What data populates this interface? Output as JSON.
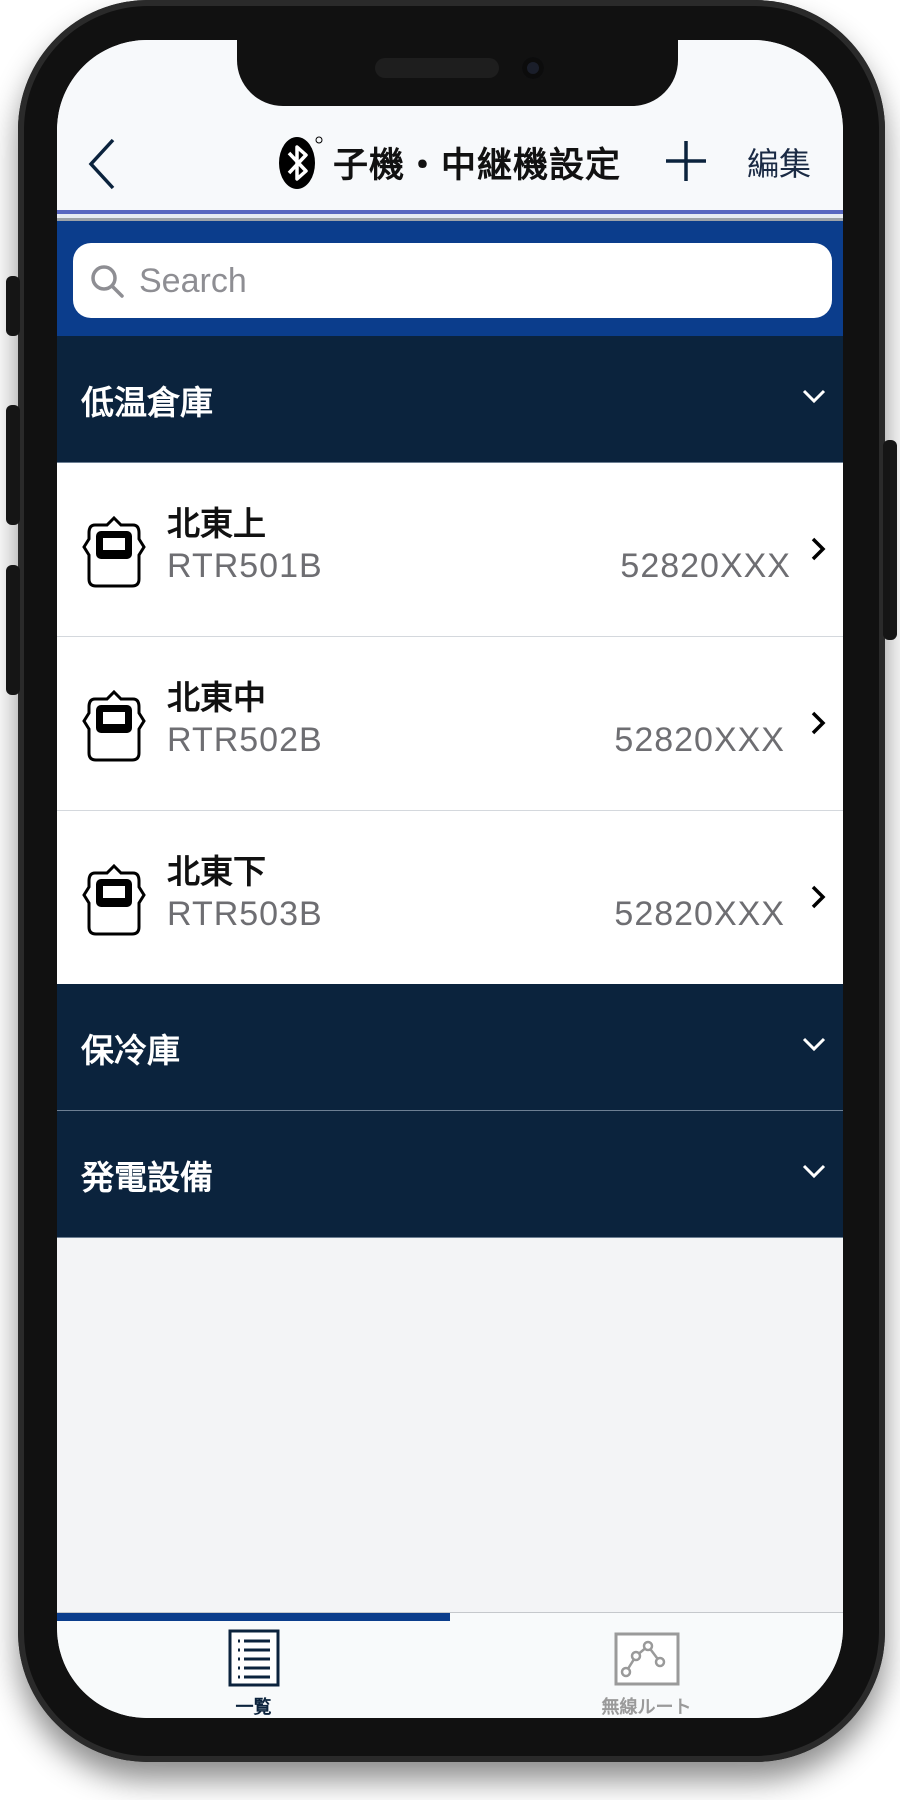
{
  "header": {
    "title": "子機・中継機設定",
    "edit_label": "編集",
    "back_icon": "chevron-left-icon",
    "add_icon": "plus-icon",
    "bluetooth_icon": "bluetooth-icon"
  },
  "search": {
    "placeholder": "Search",
    "value": ""
  },
  "sections": [
    {
      "label": "低温倉庫",
      "expanded": true,
      "devices": [
        {
          "name": "北東上",
          "model": "RTR501B",
          "serial": "52820XXX"
        },
        {
          "name": "北東中",
          "model": "RTR502B",
          "serial": "52820XXX"
        },
        {
          "name": "北東下",
          "model": "RTR503B",
          "serial": "52820XXX"
        }
      ]
    },
    {
      "label": "保冷庫",
      "expanded": false,
      "devices": []
    },
    {
      "label": "発電設備",
      "expanded": false,
      "devices": []
    }
  ],
  "tabs": [
    {
      "label": "一覧",
      "icon": "list-icon",
      "active": true
    },
    {
      "label": "無線ルート",
      "icon": "route-graph-icon",
      "active": false
    }
  ],
  "colors": {
    "search_band": "#0b3d8c",
    "section_header": "#0b233d",
    "tab_active": "#0b233d",
    "tab_inactive": "#9a9a9a"
  }
}
